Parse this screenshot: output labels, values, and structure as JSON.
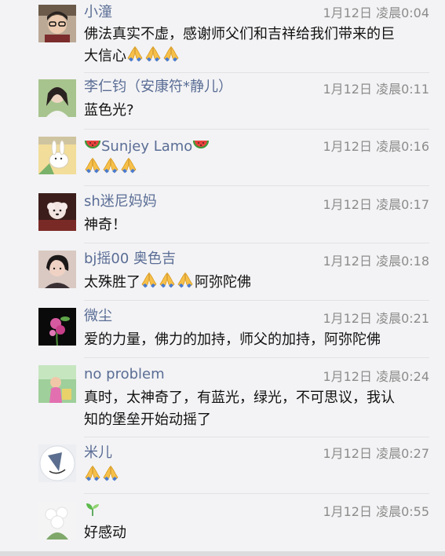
{
  "comments": [
    {
      "name": "小潼",
      "time": "1月12日 凌晨0:04",
      "text": "佛法真实不虚，感谢师父们和吉祥给我们带来的巨",
      "text2": "大信心"
    },
    {
      "name": "李仁钧（安康符*静儿）",
      "time": "1月12日 凌晨0:11",
      "text": "蓝色光?"
    },
    {
      "name": "Sunjey  Lamo",
      "time": "1月12日 凌晨0:16",
      "text": ""
    },
    {
      "name": "sh迷尼妈妈",
      "time": "1月12日 凌晨0:17",
      "text": "神奇！"
    },
    {
      "name": "bj摇00   奥色吉",
      "time": "1月12日 凌晨0:18",
      "text": "太殊胜了",
      "text_after": "阿弥陀佛"
    },
    {
      "name": "微尘",
      "time": "1月12日 凌晨0:21",
      "text": "爱的力量，佛力的加持，师父的加持，阿弥陀佛"
    },
    {
      "name": "no problem",
      "time": "1月12日 凌晨0:24",
      "text": "真时，太神奇了，有蓝光，绿光，不可思议，我认",
      "text2": "知的堡垒开始动摇了"
    },
    {
      "name": "米儿",
      "time": "1月12日 凌晨0:27",
      "text": ""
    },
    {
      "name": "",
      "time": "1月12日 凌晨0:55",
      "text": "好感动"
    }
  ],
  "icons": {
    "pray": "folded-hands-emoji",
    "melon": "watermelon-emoji",
    "sprout": "seedling-emoji"
  },
  "colors": {
    "name": "#5a6d95",
    "time": "#8c8c8c",
    "text": "#111111",
    "background": "#f3f3f5"
  }
}
